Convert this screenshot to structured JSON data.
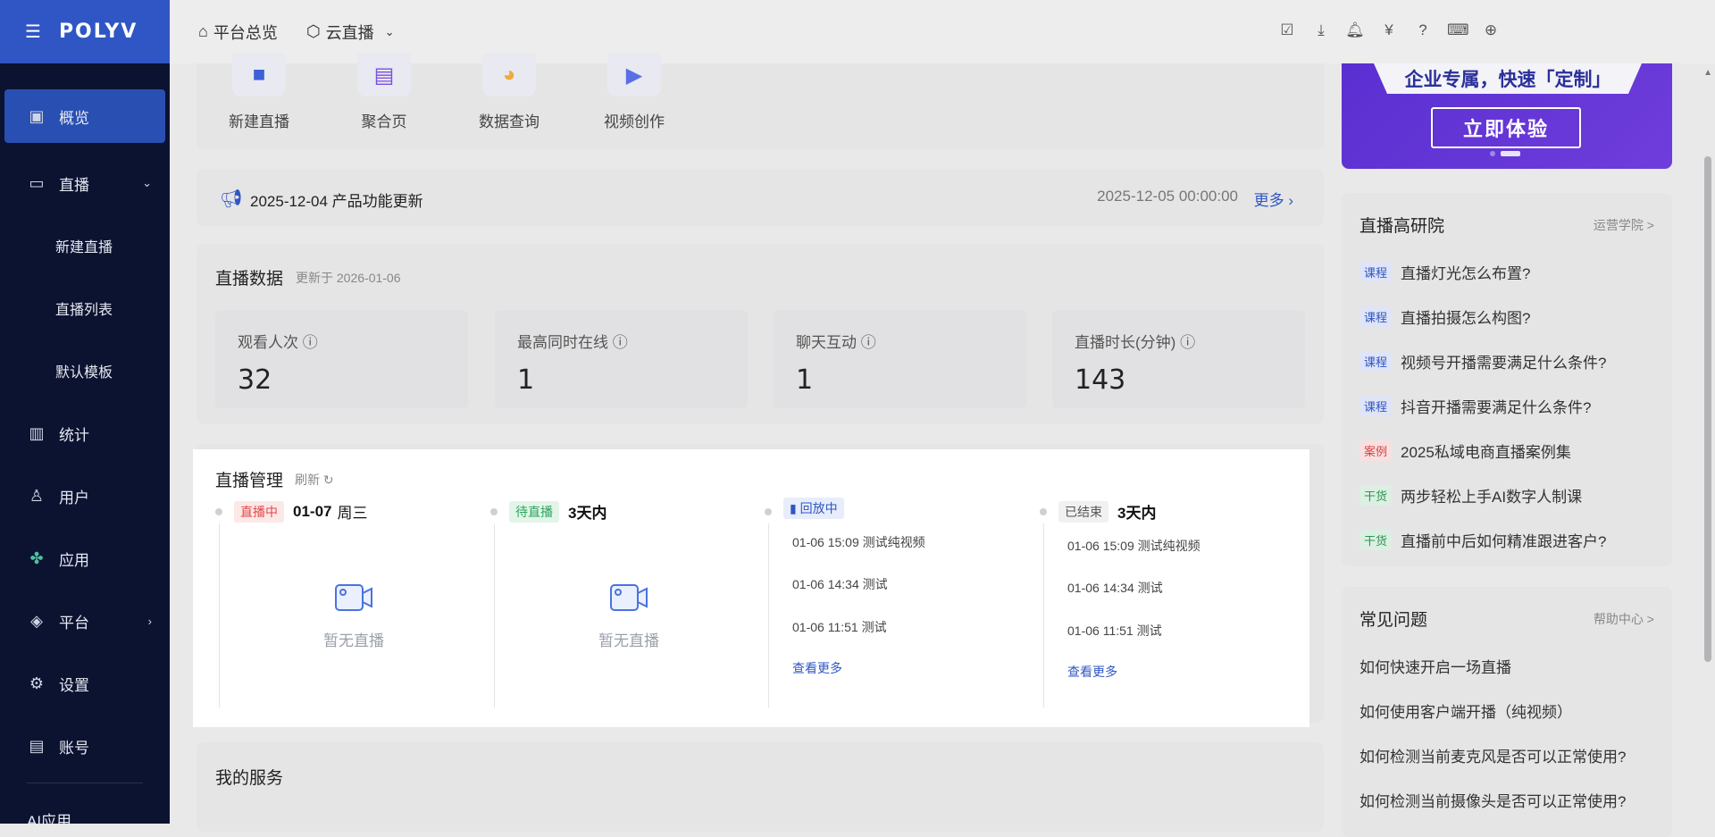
{
  "brand": {
    "logo_text": "POLYV"
  },
  "sidebar": {
    "items": [
      {
        "label": "概览",
        "icon": "chart-board-icon"
      },
      {
        "label": "直播",
        "icon": "video-camera-icon"
      },
      {
        "label": "新建直播"
      },
      {
        "label": "直播列表"
      },
      {
        "label": "默认模板"
      },
      {
        "label": "统计",
        "icon": "bar-chart-icon"
      },
      {
        "label": "用户",
        "icon": "user-icon"
      },
      {
        "label": "应用",
        "icon": "apps-icon"
      },
      {
        "label": "平台",
        "icon": "layers-icon"
      },
      {
        "label": "设置",
        "icon": "gear-icon"
      },
      {
        "label": "账号",
        "icon": "id-card-icon"
      }
    ],
    "ai_label": "AI应用"
  },
  "topbar": {
    "overview": "平台总览",
    "cloud_live": "云直播"
  },
  "shortcuts": [
    {
      "label": "新建直播",
      "color": "#3d5fd9"
    },
    {
      "label": "聚合页",
      "color": "#7b4fe0"
    },
    {
      "label": "数据查询",
      "color": "#f2a93b"
    },
    {
      "label": "视频创作",
      "color": "#5a6ee6"
    }
  ],
  "news": {
    "title": "2025-12-04 产品功能更新",
    "date": "2025-12-05 00:00:00",
    "more": "更多"
  },
  "live_data": {
    "title": "直播数据",
    "updated": "更新于 2026-01-06",
    "stats": [
      {
        "label": "观看人次",
        "value": "32"
      },
      {
        "label": "最高同时在线",
        "value": "1"
      },
      {
        "label": "聊天互动",
        "value": "1"
      },
      {
        "label": "直播时长(分钟)",
        "value": "143"
      }
    ]
  },
  "live_mgmt": {
    "title": "直播管理",
    "refresh": "刷新",
    "columns": [
      {
        "tag": "直播中",
        "date": "01-07",
        "weekday": "周三",
        "empty": "暂无直播"
      },
      {
        "tag": "待直播",
        "range": "3天内",
        "empty": "暂无直播"
      },
      {
        "tag": "回放中",
        "rows": [
          "01-06 15:09 测试纯视频",
          "01-06 14:34 测试",
          "01-06 11:51 测试"
        ],
        "more": "查看更多"
      },
      {
        "tag": "已结束",
        "range": "3天内",
        "rows": [
          "01-06 15:09 测试纯视频",
          "01-06 14:34 测试",
          "01-06 11:51 测试"
        ],
        "more": "查看更多"
      }
    ]
  },
  "services": {
    "title": "我的服务"
  },
  "banner": {
    "headline": "企业专属，快速「定制」",
    "cta": "立即体验"
  },
  "academy": {
    "title": "直播高研院",
    "link": "运营学院 >",
    "items": [
      {
        "tag": "课程",
        "text": "直播灯光怎么布置?"
      },
      {
        "tag": "课程",
        "text": "直播拍摄怎么构图?"
      },
      {
        "tag": "课程",
        "text": "视频号开播需要满足什么条件?"
      },
      {
        "tag": "课程",
        "text": "抖音开播需要满足什么条件?"
      },
      {
        "tag": "案例",
        "text": "2025私域电商直播案例集"
      },
      {
        "tag": "干货",
        "text": "两步轻松上手AI数字人制课"
      },
      {
        "tag": "干货",
        "text": "直播前中后如何精准跟进客户?"
      }
    ]
  },
  "faq": {
    "title": "常见问题",
    "link": "帮助中心 >",
    "items": [
      "如何快速开启一场直播",
      "如何使用客户端开播（纯视频）",
      "如何检测当前麦克风是否可以正常使用?",
      "如何检测当前摄像头是否可以正常使用?"
    ]
  }
}
